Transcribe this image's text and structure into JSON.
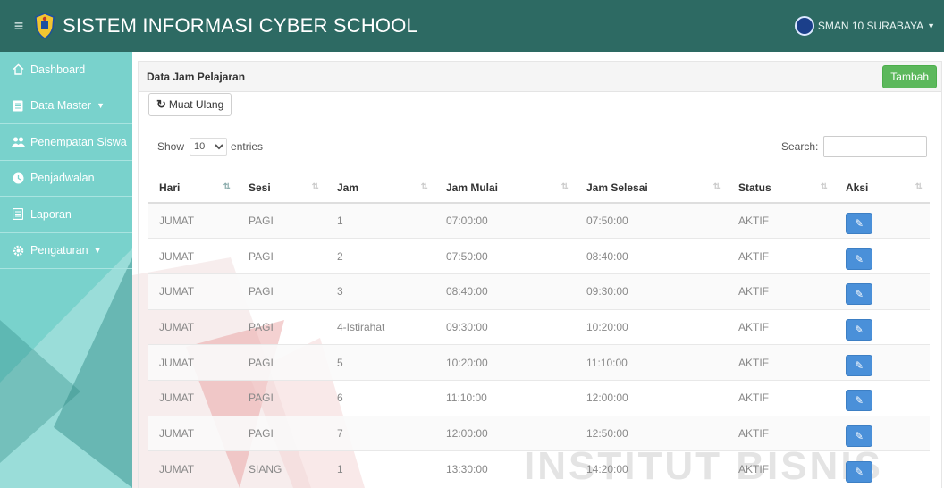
{
  "header": {
    "title": "SISTEM INFORMASI CYBER SCHOOL",
    "user_label": "SMAN 10 SURABAYA",
    "menu_icon": "hamburger-icon",
    "logo": "crest-logo"
  },
  "sidebar": {
    "items": [
      {
        "label": "Dashboard",
        "icon": "home-icon"
      },
      {
        "label": "Data Master",
        "icon": "document-icon",
        "has_caret": true
      },
      {
        "label": "Penempatan Siswa",
        "icon": "users-icon"
      },
      {
        "label": "Penjadwalan",
        "icon": "circle-icon"
      },
      {
        "label": "Laporan",
        "icon": "document-icon"
      },
      {
        "label": "Pengaturan",
        "icon": "gear-icon",
        "has_caret": true
      }
    ]
  },
  "panel": {
    "title": "Data Jam Pelajaran",
    "add_label": "Tambah",
    "reload_label": "Muat Ulang",
    "length_prefix": "Show",
    "length_value": "10",
    "length_suffix": "entries",
    "search_label": "Search:",
    "search_value": ""
  },
  "table": {
    "columns": [
      "Hari",
      "Sesi",
      "Jam",
      "Jam Mulai",
      "Jam Selesai",
      "Status",
      "Aksi"
    ],
    "rows": [
      {
        "hari": "JUMAT",
        "sesi": "PAGI",
        "jam": "1",
        "mulai": "07:00:00",
        "selesai": "07:50:00",
        "status": "AKTIF"
      },
      {
        "hari": "JUMAT",
        "sesi": "PAGI",
        "jam": "2",
        "mulai": "07:50:00",
        "selesai": "08:40:00",
        "status": "AKTIF"
      },
      {
        "hari": "JUMAT",
        "sesi": "PAGI",
        "jam": "3",
        "mulai": "08:40:00",
        "selesai": "09:30:00",
        "status": "AKTIF"
      },
      {
        "hari": "JUMAT",
        "sesi": "PAGI",
        "jam": "4-Istirahat",
        "mulai": "09:30:00",
        "selesai": "10:20:00",
        "status": "AKTIF"
      },
      {
        "hari": "JUMAT",
        "sesi": "PAGI",
        "jam": "5",
        "mulai": "10:20:00",
        "selesai": "11:10:00",
        "status": "AKTIF"
      },
      {
        "hari": "JUMAT",
        "sesi": "PAGI",
        "jam": "6",
        "mulai": "11:10:00",
        "selesai": "12:00:00",
        "status": "AKTIF"
      },
      {
        "hari": "JUMAT",
        "sesi": "PAGI",
        "jam": "7",
        "mulai": "12:00:00",
        "selesai": "12:50:00",
        "status": "AKTIF"
      },
      {
        "hari": "JUMAT",
        "sesi": "SIANG",
        "jam": "1",
        "mulai": "13:30:00",
        "selesai": "14:20:00",
        "status": "AKTIF"
      }
    ],
    "row_action_icon": "edit-icon"
  },
  "watermark": {
    "text": "INSTITUT BISNIS"
  },
  "colors": {
    "topbar": "#2d6a63",
    "sidebar": "#79d2cc",
    "add_button": "#5cb85c",
    "action_button": "#4a90d9"
  }
}
